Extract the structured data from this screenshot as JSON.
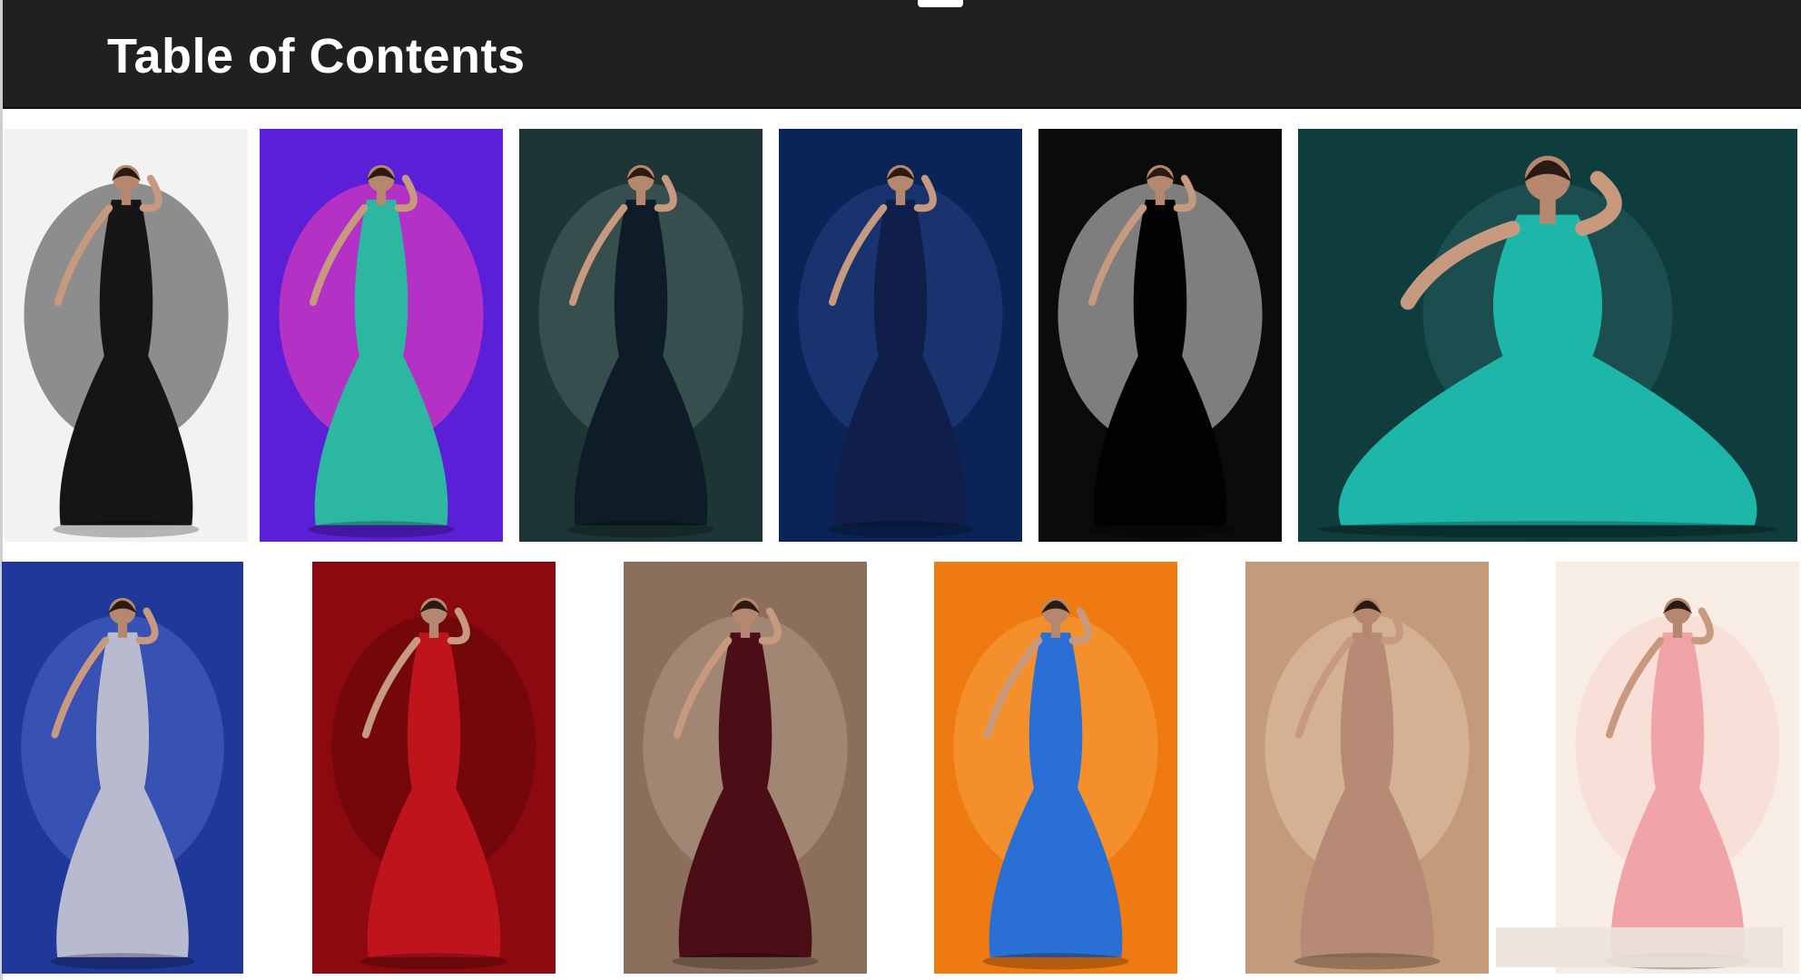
{
  "header": {
    "title": "Table of Contents"
  },
  "colors": {
    "header_bg": "#221f1f",
    "page_bg": "#ffffff"
  },
  "gallery": {
    "row1": [
      {
        "name": "lace-gown-bw-photo",
        "bg": "#f2f2f2",
        "dress": "#151515",
        "accent": "#3a3a3a"
      },
      {
        "name": "neon-sequin-gown-photo",
        "bg": "#5a1fd6",
        "dress": "#2bb7a0",
        "accent": "#ff3fb8"
      },
      {
        "name": "dark-teal-halter-gown-photo",
        "bg": "#1d3534",
        "dress": "#0d1c26",
        "accent": "#4a6564"
      },
      {
        "name": "navy-velvet-gown-photo",
        "bg": "#0b2457",
        "dress": "#0f1f49",
        "accent": "#24407f"
      },
      {
        "name": "silhouette-gown-bw-photo",
        "bg": "#0b0b0b",
        "dress": "#020202",
        "accent": "#dedede"
      },
      {
        "name": "teal-flowing-gown-photo",
        "bg": "#0f3d3e",
        "dress": "#1db6a8",
        "accent": "#2a5c5c"
      }
    ],
    "row2": [
      {
        "name": "silver-cocktail-dress-photo",
        "bg": "#21389b",
        "dress": "#b8bbd0",
        "accent": "#4d67c9"
      },
      {
        "name": "red-sculptural-dress-photo",
        "bg": "#8c0a0f",
        "dress": "#c0141c",
        "accent": "#5e0508"
      },
      {
        "name": "burgundy-velvet-gown-photo",
        "bg": "#8b6f5c",
        "dress": "#4c0e16",
        "accent": "#b49a86"
      },
      {
        "name": "blue-ruffle-dress-on-orange-photo",
        "bg": "#f07a12",
        "dress": "#2a6fd6",
        "accent": "#f5a340"
      },
      {
        "name": "gold-brocade-gown-photo",
        "bg": "#c49b7a",
        "dress": "#b68a74",
        "accent": "#e0c2a6"
      },
      {
        "name": "pink-tulle-dress-photo",
        "bg": "#f7ede4",
        "dress": "#f0a4a8",
        "accent": "#f9d6cf"
      }
    ]
  }
}
